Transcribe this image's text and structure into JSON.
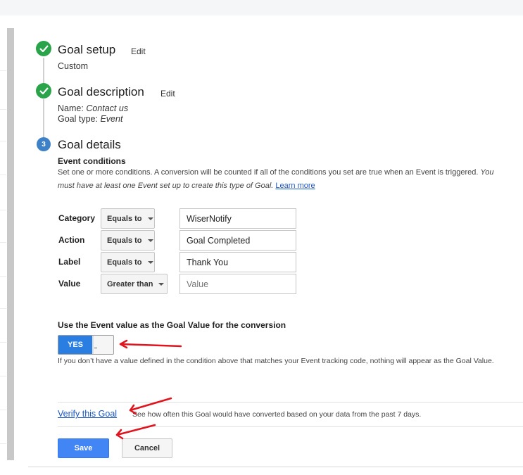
{
  "steps": [
    {
      "title": "Goal setup",
      "edit_label": "Edit",
      "detail": "Custom"
    },
    {
      "title": "Goal description",
      "edit_label": "Edit",
      "name_label": "Name:",
      "name_value": "Contact us",
      "type_label": "Goal type:",
      "type_value": "Event"
    },
    {
      "title": "Goal details",
      "number": "3"
    }
  ],
  "event_conditions": {
    "heading": "Event conditions",
    "help_text": "Set one or more conditions. A conversion will be counted if all of the conditions you set are true when an Event is triggered.",
    "help_text_italic": "You must have at least one Event set up to create this type of Goal.",
    "learn_more": "Learn more",
    "rows": [
      {
        "label": "Category",
        "operator": "Equals to",
        "value": "WiserNotify",
        "placeholder": ""
      },
      {
        "label": "Action",
        "operator": "Equals to",
        "value": "Goal Completed",
        "placeholder": ""
      },
      {
        "label": "Label",
        "operator": "Equals to",
        "value": "Thank You",
        "placeholder": ""
      },
      {
        "label": "Value",
        "operator": "Greater than",
        "value": "",
        "placeholder": "Value"
      }
    ]
  },
  "goal_value": {
    "heading": "Use the Event value as the Goal Value for the conversion",
    "toggle_label": "YES",
    "toggle_on": true,
    "help_text": "If you don’t have a value defined in the condition above that matches your Event tracking code, nothing will appear as the Goal Value."
  },
  "verify": {
    "link": "Verify this Goal",
    "description": "See how often this Goal would have converted based on your data from the past 7 days."
  },
  "buttons": {
    "save": "Save",
    "cancel": "Cancel"
  },
  "colors": {
    "accent": "#4285f4",
    "complete": "#2aa44a",
    "current_step": "#3f81c7",
    "annotation_arrow": "#e0141e",
    "link": "#1a55c8"
  },
  "icons": {
    "completed_step": "check-circle-icon",
    "annotation": "red-arrow-icon"
  }
}
